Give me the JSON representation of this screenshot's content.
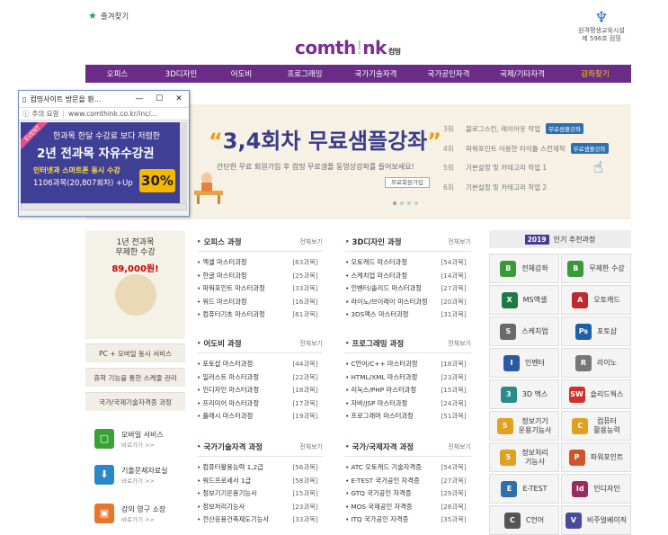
{
  "header": {
    "favorites": "즐겨찾기",
    "logo_main": "comth",
    "logo_mid": "!",
    "logo_end": "nk",
    "logo_sub": "컴띵",
    "institution_line1": "원격평생교육시설",
    "institution_line2": "제 596호 컴띵"
  },
  "nav": [
    "오피스",
    "3D디자인",
    "어도비",
    "프로그래밍",
    "국가기술자격",
    "국가공인자격",
    "국제/기타자격",
    "강좌찾기"
  ],
  "banner": {
    "title_open": "“",
    "title": "3,4회차 무료샘플강좌",
    "title_close": "”",
    "desc": "간단한 무료 회원가입 후 컴띵 무료샘플 동영상강좌를 들어보세요!",
    "button": "무료회원가입",
    "rows": [
      {
        "num": "3회",
        "text": "블로그스킨, 레이아웃 작업",
        "tag": "무료샘플강좌"
      },
      {
        "num": "4회",
        "text": "파워포인트 이용한 타이틀 스킨제작",
        "tag": "무료샘플강좌"
      },
      {
        "num": "5회",
        "text": "기본설정 및 카테고리 작업 1",
        "tag": ""
      },
      {
        "num": "6회",
        "text": "기본설정 및 카테고리 작업 2",
        "tag": ""
      }
    ]
  },
  "popup": {
    "window_title": "컴띵사이트 방문을 환...",
    "url_label": "주의 요함",
    "url": "www.comthink.co.kr/inc/...",
    "event": "EVENT",
    "line1": "한과목 한달 수강료 보다 저렴한",
    "line2": "2년 전과목 자유수강권",
    "line3": "인터넷과 스마트폰 동시 수강",
    "line4": "1106과목(20,807회차) +Up",
    "percent": "30%"
  },
  "sidebar": {
    "promo_line1": "1년 전과목",
    "promo_line2": "무제한 수강",
    "promo_price": "89,000원!",
    "menus": [
      "PC + 모바일 동시 서비스",
      "휴학 기능을 통한 스케줄 관리",
      "국가/국제기술자격증 과정"
    ],
    "services": [
      {
        "title": "모바일 서비스",
        "more": "바로가기 >>",
        "color": "#3aa235",
        "icon": "mobile-icon",
        "glyph": "▢"
      },
      {
        "title": "기출문제자료실",
        "more": "바로가기 >>",
        "color": "#2b88c8",
        "icon": "download-icon",
        "glyph": "⬇"
      },
      {
        "title": "강의 영구 소장",
        "more": "바로가기 >>",
        "color": "#e9742b",
        "icon": "archive-icon",
        "glyph": "▣"
      }
    ]
  },
  "more_label": "전체보기",
  "col1": [
    {
      "title": "오피스 과정",
      "items": [
        [
          "엑셀 마스터과정",
          "[63과목]"
        ],
        [
          "한글 마스터과정",
          "[25과목]"
        ],
        [
          "파워포인트 마스터과정",
          "[33과목]"
        ],
        [
          "워드 마스터과정",
          "[16과목]"
        ],
        [
          "컴퓨터기초 마스터과정",
          "[61과목]"
        ]
      ]
    },
    {
      "title": "어도비 과정",
      "items": [
        [
          "포토샵 마스터과정",
          "[44과목]"
        ],
        [
          "일러스트 마스터과정",
          "[22과목]"
        ],
        [
          "인디자인 마스터과정",
          "[18과목]"
        ],
        [
          "프리미어 마스터과정",
          "[17과목]"
        ],
        [
          "플래시 마스터과정",
          "[19과목]"
        ]
      ]
    },
    {
      "title": "국가기술자격 과정",
      "items": [
        [
          "컴퓨터활용능력 1,2급",
          "[56과목]"
        ],
        [
          "워드프로세서 1급",
          "[58과목]"
        ],
        [
          "정보기기운용기능사",
          "[15과목]"
        ],
        [
          "정보처리기능사",
          "[23과목]"
        ],
        [
          "전산응용건축제도기능사",
          "[33과목]"
        ]
      ]
    }
  ],
  "col2": [
    {
      "title": "3D디자인 과정",
      "items": [
        [
          "오토캐드 마스터과정",
          "[54과목]"
        ],
        [
          "스케치업 마스터과정",
          "[14과목]"
        ],
        [
          "인벤터/솔리드 마스터과정",
          "[27과목]"
        ],
        [
          "라이노/브이레이 마스터과정",
          "[20과목]"
        ],
        [
          "3DS맥스 마스터과정",
          "[31과목]"
        ]
      ]
    },
    {
      "title": "프로그래밍 과정",
      "items": [
        [
          "C언어/C++ 마스터과정",
          "[18과목]"
        ],
        [
          "HTML/XML 마스터과정",
          "[23과목]"
        ],
        [
          "리눅스/PHP 마스터과정",
          "[15과목]"
        ],
        [
          "자바/JSP 마스터과정",
          "[24과목]"
        ],
        [
          "프로그래머 마스터과정",
          "[51과목]"
        ]
      ]
    },
    {
      "title": "국가/국제자격 과정",
      "items": [
        [
          "ATC 오토캐드 기술자격증",
          "[54과목]"
        ],
        [
          "E-TEST 국가공인 자격증",
          "[27과목]"
        ],
        [
          "GTQ 국가공인 자격증",
          "[29과목]"
        ],
        [
          "MOS 국제공인 자격증",
          "[28과목]"
        ],
        [
          "ITQ 국가공인 자격증",
          "[35과목]"
        ]
      ]
    }
  ],
  "recommend": {
    "year": "2019",
    "title": "인기 추천과정",
    "cells": [
      {
        "label": "전체강좌",
        "icon": "best-icon",
        "color": "#3a9a3a",
        "glyph": "B"
      },
      {
        "label": "무제한 수강",
        "icon": "best-icon",
        "color": "#3a9a3a",
        "glyph": "B"
      },
      {
        "label": "MS엑셀",
        "icon": "excel-icon",
        "color": "#1d7a45",
        "glyph": "X"
      },
      {
        "label": "오토캐드",
        "icon": "autocad-icon",
        "color": "#c0282d",
        "glyph": "A"
      },
      {
        "label": "스케치업",
        "icon": "sketchup-icon",
        "color": "#6a6a6a",
        "glyph": "S"
      },
      {
        "label": "포토샵",
        "icon": "photoshop-icon",
        "color": "#1f5fa8",
        "glyph": "Ps"
      },
      {
        "label": "인벤터",
        "icon": "inventor-icon",
        "color": "#2a5aa0",
        "glyph": "I"
      },
      {
        "label": "라이노",
        "icon": "rhino-icon",
        "color": "#777777",
        "glyph": "R"
      },
      {
        "label": "3D 맥스",
        "icon": "3dsmax-icon",
        "color": "#2b8a8a",
        "glyph": "3"
      },
      {
        "label": "솔리드웍스",
        "icon": "solidworks-icon",
        "color": "#d0312d",
        "glyph": "SW"
      },
      {
        "label": "정보기기\n운용기능사",
        "icon": "cert-icon",
        "color": "#e0a020",
        "glyph": "5"
      },
      {
        "label": "컴퓨터\n활용능력",
        "icon": "computer-icon",
        "color": "#e0a020",
        "glyph": "C"
      },
      {
        "label": "정보처리\n기능사",
        "icon": "cert-icon",
        "color": "#e0a020",
        "glyph": "5"
      },
      {
        "label": "파워포인트",
        "icon": "powerpoint-icon",
        "color": "#d0552b",
        "glyph": "P"
      },
      {
        "label": "E-TEST",
        "icon": "etest-icon",
        "color": "#2f6fb0",
        "glyph": "E"
      },
      {
        "label": "인디자인",
        "icon": "indesign-icon",
        "color": "#9b2a5e",
        "glyph": "Id"
      },
      {
        "label": "C언어",
        "icon": "c-icon",
        "color": "#555555",
        "glyph": "C"
      },
      {
        "label": "비주얼베이직",
        "icon": "vb-icon",
        "color": "#4a4a9a",
        "glyph": "V"
      }
    ]
  }
}
